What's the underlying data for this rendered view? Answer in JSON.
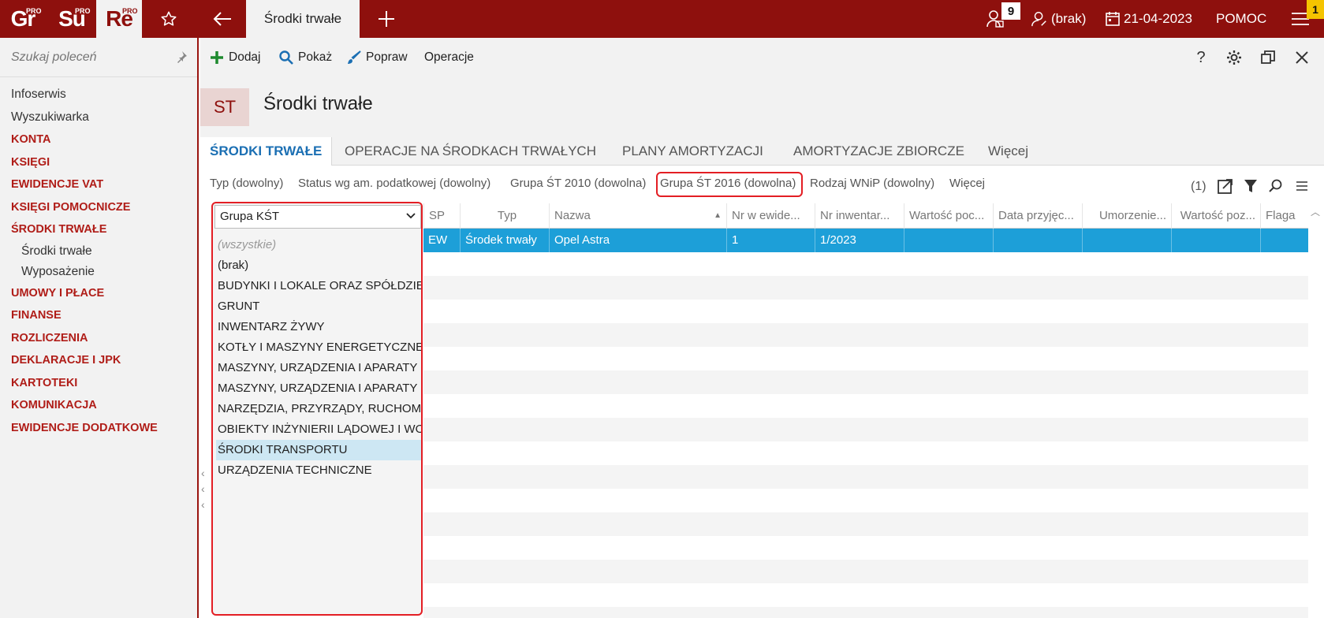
{
  "topbar": {
    "apps": [
      {
        "label": "Gr",
        "sup": "PRO"
      },
      {
        "label": "Su",
        "sup": "PRO"
      },
      {
        "label": "Re",
        "sup": "PRO"
      }
    ],
    "active_tab": "Środki trwałe",
    "notifications_count": "9",
    "user": "(brak)",
    "date": "21-04-2023",
    "help": "POMOC",
    "corner_badge": "1"
  },
  "sidebar": {
    "search_placeholder": "Szukaj poleceń",
    "items": [
      {
        "label": "Infoserwis"
      },
      {
        "label": "Wyszukiwarka"
      },
      {
        "label": "KONTA"
      },
      {
        "label": "KSIĘGI"
      },
      {
        "label": "EWIDENCJE VAT"
      },
      {
        "label": "KSIĘGI POMOCNICZE"
      },
      {
        "label": "ŚRODKI TRWAŁE"
      },
      {
        "label": "Środki trwałe"
      },
      {
        "label": "Wyposażenie"
      },
      {
        "label": "UMOWY I PŁACE"
      },
      {
        "label": "FINANSE"
      },
      {
        "label": "ROZLICZENIA"
      },
      {
        "label": "DEKLARACJE I JPK"
      },
      {
        "label": "KARTOTEKI"
      },
      {
        "label": "KOMUNIKACJA"
      },
      {
        "label": "EWIDENCJE DODATKOWE"
      }
    ]
  },
  "toolbar": {
    "add": "Dodaj",
    "show": "Pokaż",
    "fix": "Popraw",
    "operations": "Operacje"
  },
  "title": {
    "badge": "ST",
    "text": "Środki trwałe"
  },
  "tabs": [
    {
      "label": "ŚRODKI TRWAŁE"
    },
    {
      "label": "OPERACJE NA ŚRODKACH TRWAŁYCH"
    },
    {
      "label": "PLANY AMORTYZACJI"
    },
    {
      "label": "AMORTYZACJE ZBIORCZE"
    },
    {
      "label": "Więcej"
    }
  ],
  "filters": [
    {
      "label": "Typ (dowolny)"
    },
    {
      "label": "Status wg am. podatkowej (dowolny)"
    },
    {
      "label": "Grupa ŚT 2010 (dowolna)"
    },
    {
      "label": "Grupa ŚT 2016 (dowolna)"
    },
    {
      "label": "Rodzaj WNiP (dowolny)"
    },
    {
      "label": "Więcej"
    }
  ],
  "filter_count": "(1)",
  "group_panel": {
    "selected": "Grupa KŚT",
    "items": [
      {
        "label": "(wszystkie)"
      },
      {
        "label": "(brak)"
      },
      {
        "label": "BUDYNKI I LOKALE ORAZ SPÓŁDZIELCZE"
      },
      {
        "label": "GRUNT"
      },
      {
        "label": "INWENTARZ ŻYWY"
      },
      {
        "label": "KOTŁY I MASZYNY ENERGETYCZNE"
      },
      {
        "label": "MASZYNY, URZĄDZENIA I APARATY OGÓLNEGO"
      },
      {
        "label": "MASZYNY, URZĄDZENIA I APARATY SPECJALISTYCZNE"
      },
      {
        "label": "NARZĘDZIA, PRZYRZĄDY, RUCHOMOŚCI"
      },
      {
        "label": "OBIEKTY INŻYNIERII LĄDOWEJ I WODNEJ"
      },
      {
        "label": "ŚRODKI TRANSPORTU"
      },
      {
        "label": "URZĄDZENIA TECHNICZNE"
      }
    ]
  },
  "grid": {
    "columns": [
      {
        "label": "SP"
      },
      {
        "label": "Typ"
      },
      {
        "label": "Nazwa"
      },
      {
        "label": "Nr w ewide..."
      },
      {
        "label": "Nr inwentar..."
      },
      {
        "label": "Wartość poc..."
      },
      {
        "label": "Data przyjęc..."
      },
      {
        "label": "Umorzenie..."
      },
      {
        "label": "Wartość poz..."
      },
      {
        "label": "Flaga"
      }
    ],
    "rows": [
      {
        "sp": "EW",
        "typ": "Środek trwały",
        "nazwa": "Opel Astra",
        "nr_ewid": "1",
        "nr_inw": "1/2023"
      }
    ]
  }
}
